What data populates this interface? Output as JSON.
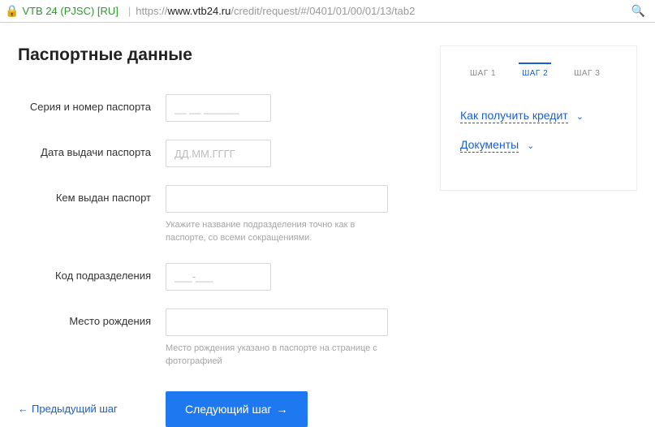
{
  "browser": {
    "cert_label": "VTB 24 (PJSC) [RU]",
    "url_proto": "https://",
    "url_host": "www.vtb24.ru",
    "url_path": "/credit/request/#/0401/01/00/01/13/tab2"
  },
  "title": "Паспортные данные",
  "fields": {
    "series": {
      "label": "Серия и номер паспорта",
      "placeholder": "__ __ ______"
    },
    "issue_date": {
      "label": "Дата выдачи паспорта",
      "placeholder": "ДД.ММ.ГГГГ"
    },
    "issued_by": {
      "label": "Кем выдан паспорт",
      "hint": "Укажите название подразделения точно как в паспорте, со всеми сокращениями."
    },
    "dept_code": {
      "label": "Код подразделения",
      "placeholder": "___-___"
    },
    "birthplace": {
      "label": "Место рождения",
      "hint": "Место рождения указано в паспорте на странице с фотографией"
    }
  },
  "actions": {
    "prev": "Предыдущий шаг",
    "next": "Следующий шаг"
  },
  "sidebar": {
    "steps": [
      "ШАГ 1",
      "ШАГ 2",
      "ШАГ 3"
    ],
    "active_step": 1,
    "links": {
      "how": "Как получить кредит",
      "docs": "Документы"
    }
  }
}
